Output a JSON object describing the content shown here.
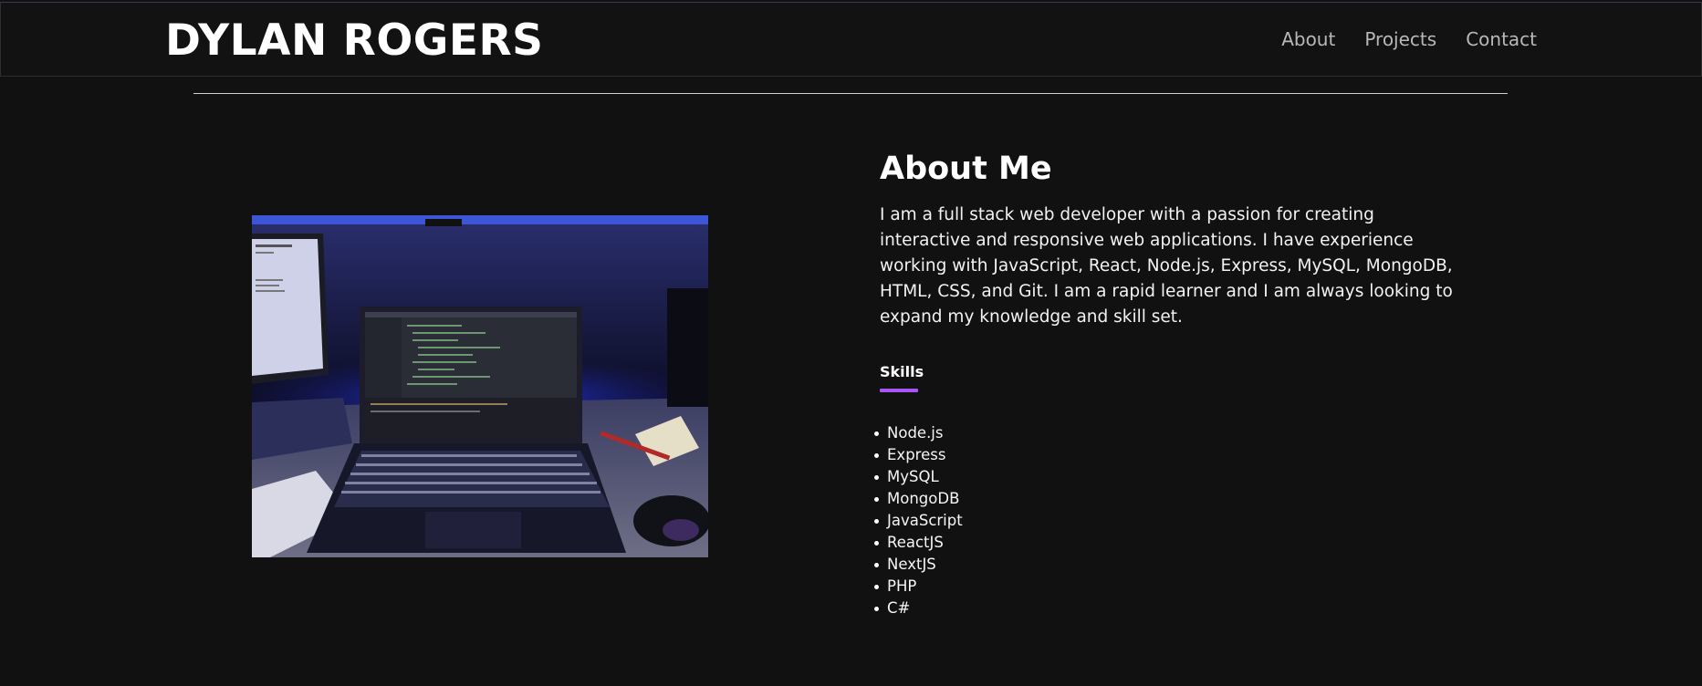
{
  "header": {
    "brand": "DYLAN ROGERS",
    "nav": [
      "About",
      "Projects",
      "Contact"
    ]
  },
  "about": {
    "title": "About Me",
    "paragraph": "I am a full stack web developer with a passion for creating interactive and responsive web applications. I have experience working with JavaScript, React, Node.js, Express, MySQL, MongoDB, HTML, CSS, and Git. I am a rapid learner and I am always looking to expand my knowledge and skill set."
  },
  "skills": {
    "title": "Skills",
    "accent_color": "#a855f7",
    "items": [
      "Node.js",
      "Express",
      "MySQL",
      "MongoDB",
      "JavaScript",
      "ReactJS",
      "NextJS",
      "PHP",
      "C#"
    ]
  },
  "photo": {
    "subject": "laptop-on-desk-photo"
  },
  "colors": {
    "background": "#111111",
    "nav_text": "#b8b8b8"
  }
}
